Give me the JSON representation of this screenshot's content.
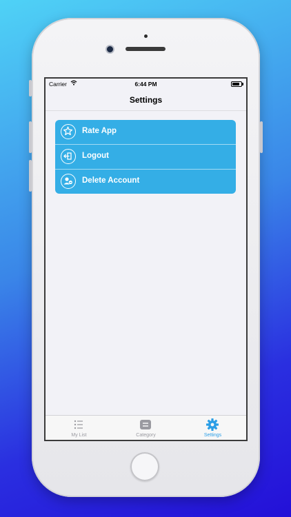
{
  "status_bar": {
    "carrier": "Carrier",
    "time": "6:44 PM",
    "battery_level": 0.9
  },
  "nav": {
    "title": "Settings"
  },
  "menu": [
    {
      "label": "Rate App",
      "icon": "star-icon"
    },
    {
      "label": "Logout",
      "icon": "logout-icon"
    },
    {
      "label": "Delete Account",
      "icon": "delete-user-icon"
    }
  ],
  "tabs": [
    {
      "label": "My List",
      "icon": "list-icon",
      "active": false
    },
    {
      "label": "Category",
      "icon": "category-icon",
      "active": false
    },
    {
      "label": "Settings",
      "icon": "gear-icon",
      "active": true
    }
  ],
  "colors": {
    "accent": "#34aee6",
    "tab_active": "#2b9ee6",
    "tab_inactive": "#9a9aa0",
    "screen_bg": "#f2f2f7"
  }
}
